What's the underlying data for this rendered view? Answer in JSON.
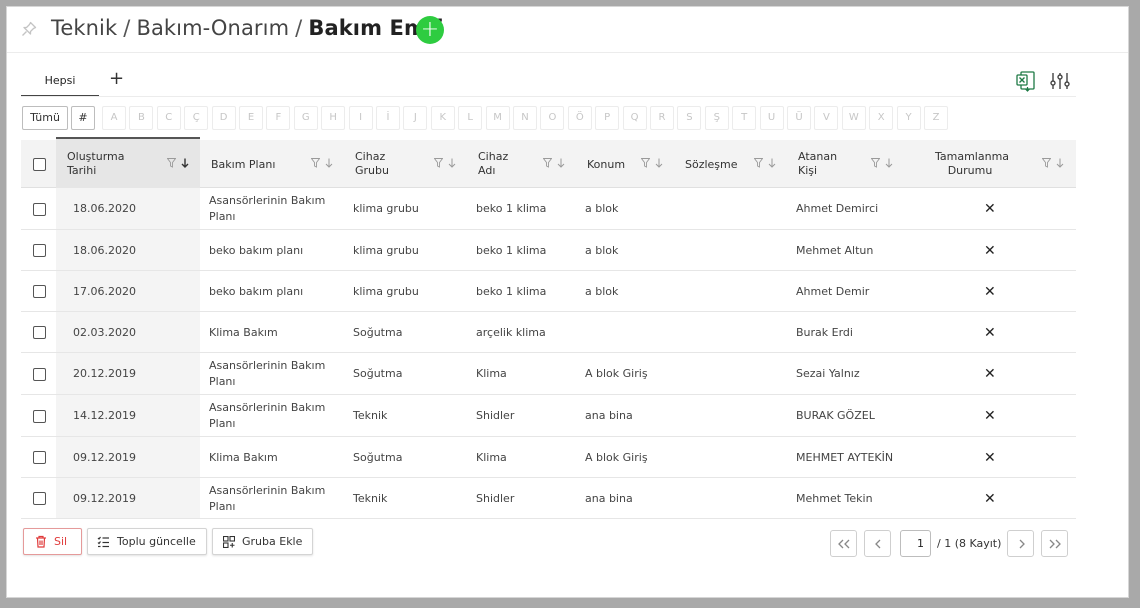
{
  "breadcrumb": {
    "part1": "Teknik",
    "sep1": "/",
    "part2": "Bakım-Onarım",
    "sep2": "/",
    "current": "Bakım Emri"
  },
  "add_button": {
    "label": "+"
  },
  "tabs": [
    {
      "label": "Hepsi"
    }
  ],
  "tab_add": {
    "label": "+"
  },
  "toolbar": {
    "excel_icon": "excel-export-icon",
    "settings_icon": "sliders-icon"
  },
  "alpha_filter": {
    "all_label": "Tümü",
    "hash_label": "#",
    "letters": [
      "A",
      "B",
      "C",
      "Ç",
      "D",
      "E",
      "F",
      "G",
      "H",
      "I",
      "İ",
      "J",
      "K",
      "L",
      "M",
      "N",
      "O",
      "Ö",
      "P",
      "Q",
      "R",
      "S",
      "Ş",
      "T",
      "U",
      "Ü",
      "V",
      "W",
      "X",
      "Y",
      "Z"
    ]
  },
  "table": {
    "columns": {
      "created_line1": "Oluşturma",
      "created_line2": "Tarihi",
      "plan": "Bakım Planı",
      "group_line1": "Cihaz",
      "group_line2": "Grubu",
      "device_line1": "Cihaz",
      "device_line2": "Adı",
      "location": "Konum",
      "contract": "Sözleşme",
      "assigned_line1": "Atanan",
      "assigned_line2": "Kişi",
      "status_line1": "Tamamlanma",
      "status_line2": "Durumu"
    },
    "rows": [
      {
        "date": "18.06.2020",
        "plan": "Asansörlerinin Bakım Planı",
        "group": "klima grubu",
        "device": "beko 1 klima",
        "location": "a blok",
        "contract": "",
        "assigned": "Ahmet Demirci",
        "status": "✕"
      },
      {
        "date": "18.06.2020",
        "plan": "beko bakım planı",
        "group": "klima grubu",
        "device": "beko 1 klima",
        "location": "a blok",
        "contract": "",
        "assigned": "Mehmet Altun",
        "status": "✕"
      },
      {
        "date": "17.06.2020",
        "plan": "beko bakım planı",
        "group": "klima grubu",
        "device": "beko 1 klima",
        "location": "a blok",
        "contract": "",
        "assigned": "Ahmet Demir",
        "status": "✕"
      },
      {
        "date": "02.03.2020",
        "plan": "Klima Bakım",
        "group": "Soğutma",
        "device": "arçelik klima",
        "location": "",
        "contract": "",
        "assigned": "Burak Erdi",
        "status": "✕"
      },
      {
        "date": "20.12.2019",
        "plan": "Asansörlerinin Bakım Planı",
        "group": "Soğutma",
        "device": "Klima",
        "location": "A blok Giriş",
        "contract": "",
        "assigned": "Sezai Yalnız",
        "status": "✕"
      },
      {
        "date": "14.12.2019",
        "plan": "Asansörlerinin Bakım Planı",
        "group": "Teknik",
        "device": "Shidler",
        "location": "ana bina",
        "contract": "",
        "assigned": "BURAK GÖZEL",
        "status": "✕"
      },
      {
        "date": "09.12.2019",
        "plan": "Klima Bakım",
        "group": "Soğutma",
        "device": "Klima",
        "location": "A blok Giriş",
        "contract": "",
        "assigned": "MEHMET AYTEKİN",
        "status": "✕"
      },
      {
        "date": "09.12.2019",
        "plan": "Asansörlerinin Bakım Planı",
        "group": "Teknik",
        "device": "Shidler",
        "location": "ana bina",
        "contract": "",
        "assigned": "Mehmet Tekin",
        "status": "✕"
      }
    ]
  },
  "footer": {
    "delete_label": "Sil",
    "bulk_update_label": "Toplu güncelle",
    "add_group_label": "Gruba Ekle"
  },
  "pager": {
    "page_value": "1",
    "summary": "/ 1 (8 Kayıt)"
  },
  "colors": {
    "accent_green": "#2ecc40",
    "danger": "#e03b3b"
  }
}
